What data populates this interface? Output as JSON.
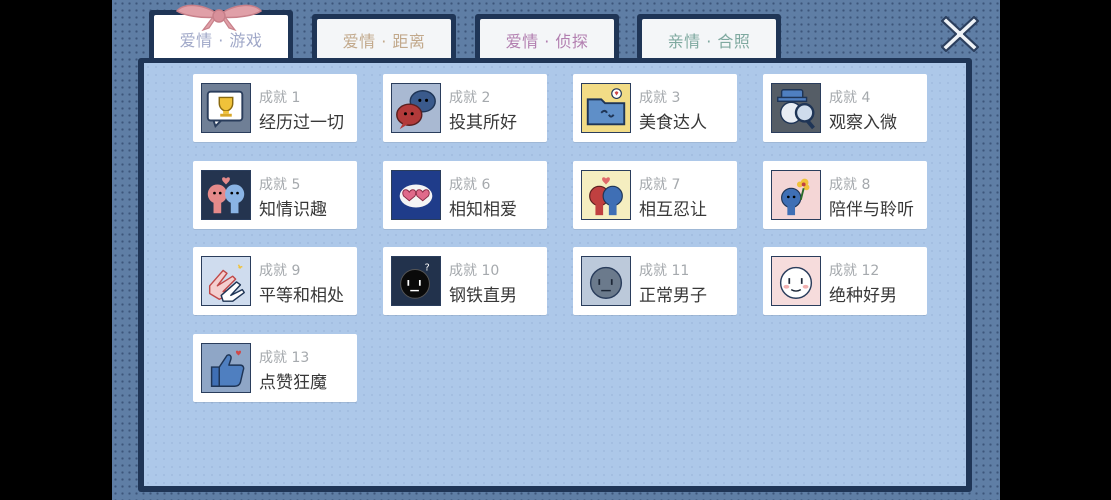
{
  "tabs": [
    {
      "label": "爱情 · 游戏",
      "color": "#a0a8c8",
      "active": true
    },
    {
      "label": "爱情 · 距离",
      "color": "#c2a98c",
      "active": false
    },
    {
      "label": "爱情 · 侦探",
      "color": "#b27fb0",
      "active": false
    },
    {
      "label": "亲情 · 合照",
      "color": "#7fa9a0",
      "active": false
    }
  ],
  "close_icon": "close-icon",
  "achievements": [
    {
      "number": "成就 1",
      "name": "经历过一切",
      "icon": "trophy-icon"
    },
    {
      "number": "成就 2",
      "name": "投其所好",
      "icon": "chat-bubbles-icon"
    },
    {
      "number": "成就 3",
      "name": "美食达人",
      "icon": "folder-face-icon"
    },
    {
      "number": "成就 4",
      "name": "观察入微",
      "icon": "magnifier-detective-icon"
    },
    {
      "number": "成就 5",
      "name": "知情识趣",
      "icon": "couple-icon"
    },
    {
      "number": "成就 6",
      "name": "相知相爱",
      "icon": "hearts-cloud-icon"
    },
    {
      "number": "成就 7",
      "name": "相互忍让",
      "icon": "couple-heart-icon"
    },
    {
      "number": "成就 8",
      "name": "陪伴与聆听",
      "icon": "flower-friend-icon"
    },
    {
      "number": "成就 9",
      "name": "平等和相处",
      "icon": "clapping-hands-icon"
    },
    {
      "number": "成就 10",
      "name": "钢铁直男",
      "icon": "dark-face-icon"
    },
    {
      "number": "成就 11",
      "name": "正常男子",
      "icon": "grey-face-icon"
    },
    {
      "number": "成就 12",
      "name": "绝种好男",
      "icon": "white-face-icon"
    },
    {
      "number": "成就 13",
      "name": "点赞狂魔",
      "icon": "thumbs-up-icon"
    }
  ]
}
